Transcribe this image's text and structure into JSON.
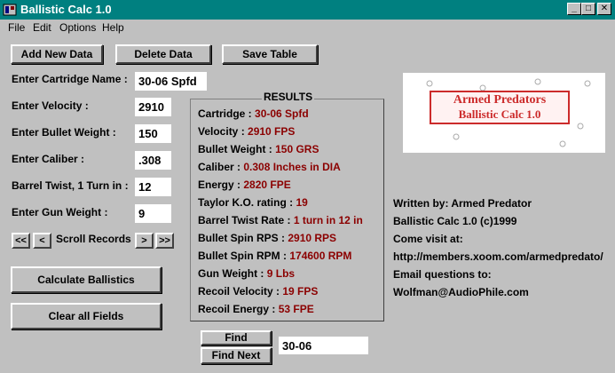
{
  "window": {
    "title": "Ballistic Calc 1.0"
  },
  "menu": [
    "File",
    "Edit",
    "Options",
    "Help"
  ],
  "toolbar": {
    "add_label": "Add New Data",
    "delete_label": "Delete Data",
    "save_label": "Save Table"
  },
  "inputs": [
    {
      "label": "Enter Cartridge Name :",
      "value": "30-06 Spfd"
    },
    {
      "label": "Enter Velocity :",
      "value": "2910"
    },
    {
      "label": "Enter Bullet Weight :",
      "value": "150"
    },
    {
      "label": "Enter Caliber :",
      "value": ".308"
    },
    {
      "label": "Barrel Twist, 1 Turn in :",
      "value": "12"
    },
    {
      "label": "Enter Gun Weight :",
      "value": "9"
    }
  ],
  "scroll": {
    "label": "Scroll Records",
    "first": "<<",
    "prev": "<",
    "next": ">",
    "last": ">>"
  },
  "actions": {
    "calculate_label": "Calculate Ballistics",
    "clear_label": "Clear all Fields"
  },
  "results": {
    "title": "RESULTS",
    "rows": [
      {
        "label": "Cartridge : ",
        "value": "30-06 Spfd"
      },
      {
        "label": "Velocity : ",
        "value": "2910 FPS"
      },
      {
        "label": "Bullet Weight : ",
        "value": "150 GRS"
      },
      {
        "label": "Caliber : ",
        "value": "0.308 Inches in DIA"
      },
      {
        "label": "Energy : ",
        "value": "2820 FPE"
      },
      {
        "label": "Taylor K.O. rating : ",
        "value": "19"
      },
      {
        "label": "Barrel Twist Rate : ",
        "value": "1 turn in 12 in"
      },
      {
        "label": "Bullet Spin RPS : ",
        "value": "2910 RPS"
      },
      {
        "label": "Bullet Spin RPM : ",
        "value": "174600 RPM"
      },
      {
        "label": "Gun Weight : ",
        "value": "9 Lbs"
      },
      {
        "label": "Recoil Velocity : ",
        "value": "19 FPS"
      },
      {
        "label": "Recoil Energy : ",
        "value": "53 FPE"
      }
    ]
  },
  "find": {
    "find_label": "Find",
    "find_next_label": "Find Next",
    "value": "30-06"
  },
  "logo": {
    "line1": "Armed Predators",
    "line2": "Ballistic Calc 1.0",
    "color": "#cc2b2b"
  },
  "info": [
    "Written by: Armed Predator",
    "Ballistic Calc 1.0 (c)1999",
    "Come visit at:",
    "http://members.xoom.com/armedpredato/",
    "Email questions to:",
    "Wolfman@AudioPhile.com"
  ],
  "colors": {
    "titlebar": "#008080",
    "result_value": "#8b0000",
    "background": "#c0c0c0"
  }
}
